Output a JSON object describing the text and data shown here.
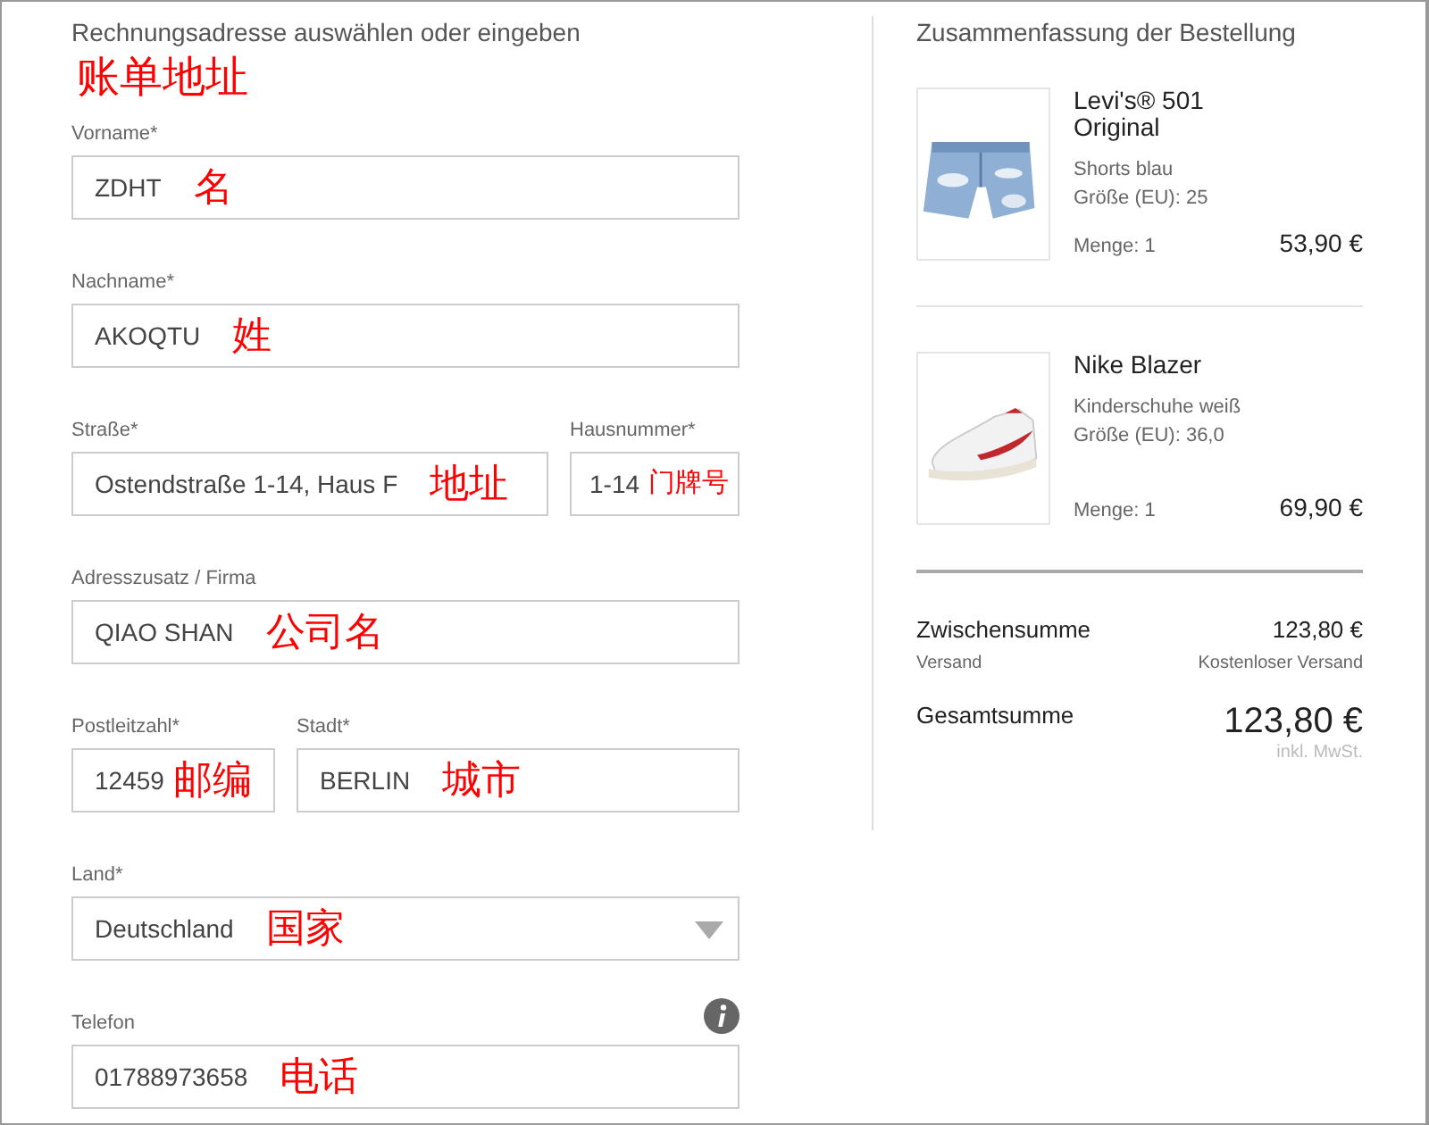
{
  "billing": {
    "title": "Rechnungsadresse auswählen oder eingeben",
    "note": "账单地址",
    "rows": [
      {
        "fields": [
          {
            "kind": "text",
            "label": "Vorname*",
            "value": "ZDHT",
            "note": "名"
          }
        ]
      },
      {
        "fields": [
          {
            "kind": "text",
            "label": "Nachname*",
            "value": "AKOQTU",
            "note": "姓"
          }
        ]
      },
      {
        "fields": [
          {
            "kind": "text",
            "label": "Straße*",
            "value": "Ostendstraße 1-14, Haus F",
            "note": "地址"
          },
          {
            "kind": "text",
            "label": "Hausnummer*",
            "value": "1-14",
            "note": "门牌号"
          }
        ]
      },
      {
        "fields": [
          {
            "kind": "text",
            "label": "Adresszusatz / Firma",
            "value": "QIAO SHAN",
            "note": "公司名"
          }
        ]
      },
      {
        "fields": [
          {
            "kind": "text",
            "label": "Postleitzahl*",
            "value": "12459",
            "note": "邮编"
          },
          {
            "kind": "text",
            "label": "Stadt*",
            "value": "BERLIN",
            "note": "城市"
          }
        ]
      },
      {
        "fields": [
          {
            "kind": "select",
            "label": "Land*",
            "value": "Deutschland",
            "note": "国家"
          }
        ]
      },
      {
        "fields": [
          {
            "kind": "text",
            "label": "Telefon",
            "value": "01788973658",
            "note": "电话",
            "info": true
          }
        ]
      }
    ]
  },
  "summary": {
    "title": "Zusammenfassung der Bestellung",
    "items": [
      {
        "kind": "shorts",
        "name": "Levi's® 501 Original",
        "description": "Shorts blau",
        "size": "Größe (EU): 25",
        "quantity": "Menge: 1",
        "price": "53,90 €"
      },
      {
        "kind": "sneaker",
        "name": "Nike Blazer",
        "description": "Kinderschuhe weiß",
        "size": "Größe (EU): 36,0",
        "quantity": "Menge: 1",
        "price": "69,90 €"
      }
    ],
    "subtotal_label": "Zwischensumme",
    "subtotal": "123,80 €",
    "shipping_label": "Versand",
    "shipping": "Kostenloser Versand",
    "total_label": "Gesamtsumme",
    "total": "123,80 €",
    "tax_note": "inkl. MwSt."
  }
}
